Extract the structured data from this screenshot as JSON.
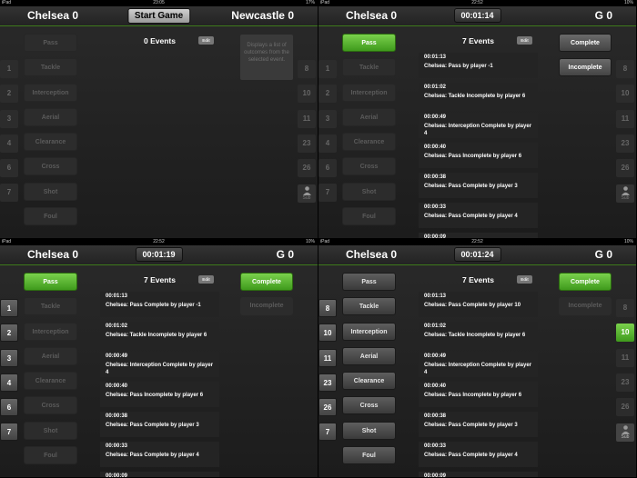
{
  "panels": [
    {
      "status": {
        "carrier": "iPad",
        "time": "23:05",
        "battery": "17%"
      },
      "home": "Chelsea 0",
      "away": "Newcastle 0",
      "clock": "Start Game",
      "events_count": "0 Events",
      "edit": "Edit",
      "hint": "Displays a list of outcomes from the selected event.",
      "events": [
        {
          "label": "Pass",
          "state": "disabled"
        },
        {
          "label": "Tackle",
          "state": "disabled"
        },
        {
          "label": "Interception",
          "state": "disabled"
        },
        {
          "label": "Aerial",
          "state": "disabled"
        },
        {
          "label": "Clearance",
          "state": "disabled"
        },
        {
          "label": "Cross",
          "state": "disabled"
        },
        {
          "label": "Shot",
          "state": "disabled"
        },
        {
          "label": "Foul",
          "state": "disabled"
        }
      ],
      "left_numbers": [
        {
          "n": "1",
          "state": "disabled"
        },
        {
          "n": "2",
          "state": "disabled"
        },
        {
          "n": "3",
          "state": "disabled"
        },
        {
          "n": "4",
          "state": "disabled"
        },
        {
          "n": "6",
          "state": "disabled"
        },
        {
          "n": "7",
          "state": "disabled"
        }
      ],
      "right_numbers": [
        {
          "n": "8",
          "state": "disabled"
        },
        {
          "n": "10",
          "state": "disabled"
        },
        {
          "n": "11",
          "state": "disabled"
        },
        {
          "n": "23",
          "state": "disabled"
        },
        {
          "n": "26",
          "state": "disabled"
        }
      ],
      "sub_label": "Sub",
      "sub_state": "disabled",
      "outcomes": [],
      "log": []
    },
    {
      "status": {
        "carrier": "iPad",
        "time": "22:52",
        "battery": "10%"
      },
      "home": "Chelsea 0",
      "away": "G 0",
      "clock": "00:01:14",
      "events_count": "7 Events",
      "edit": "Edit",
      "hint": "",
      "events": [
        {
          "label": "Pass",
          "state": "active"
        },
        {
          "label": "Tackle",
          "state": "disabled"
        },
        {
          "label": "Interception",
          "state": "disabled"
        },
        {
          "label": "Aerial",
          "state": "disabled"
        },
        {
          "label": "Clearance",
          "state": "disabled"
        },
        {
          "label": "Cross",
          "state": "disabled"
        },
        {
          "label": "Shot",
          "state": "disabled"
        },
        {
          "label": "Foul",
          "state": "disabled"
        }
      ],
      "left_numbers": [
        {
          "n": "1",
          "state": "disabled"
        },
        {
          "n": "2",
          "state": "disabled"
        },
        {
          "n": "3",
          "state": "disabled"
        },
        {
          "n": "4",
          "state": "disabled"
        },
        {
          "n": "6",
          "state": "disabled"
        },
        {
          "n": "7",
          "state": "disabled"
        }
      ],
      "right_numbers": [
        {
          "n": "8",
          "state": "disabled"
        },
        {
          "n": "10",
          "state": "disabled"
        },
        {
          "n": "11",
          "state": "disabled"
        },
        {
          "n": "23",
          "state": "disabled"
        },
        {
          "n": "26",
          "state": "disabled"
        }
      ],
      "sub_label": "Sub",
      "sub_state": "disabled",
      "outcomes": [
        {
          "label": "Complete",
          "state": "normal"
        },
        {
          "label": "Incomplete",
          "state": "normal"
        }
      ],
      "log": [
        {
          "time": "00:01:13",
          "text": "Chelsea: Pass by player -1"
        },
        {
          "time": "00:01:02",
          "text": "Chelsea: Tackle Incomplete by player 6"
        },
        {
          "time": "00:00:49",
          "text": "Chelsea: Interception Complete by player 4"
        },
        {
          "time": "00:00:40",
          "text": "Chelsea: Pass Incomplete by player 6"
        },
        {
          "time": "00:00:38",
          "text": "Chelsea: Pass Complete by player 3"
        },
        {
          "time": "00:00:33",
          "text": "Chelsea: Pass Complete by player 4"
        },
        {
          "time": "00:00:09",
          "text": ""
        }
      ]
    },
    {
      "status": {
        "carrier": "iPad",
        "time": "22:52",
        "battery": "10%"
      },
      "home": "Chelsea 0",
      "away": "G 0",
      "clock": "00:01:19",
      "events_count": "7 Events",
      "edit": "Edit",
      "hint": "",
      "events": [
        {
          "label": "Pass",
          "state": "active"
        },
        {
          "label": "Tackle",
          "state": "disabled"
        },
        {
          "label": "Interception",
          "state": "disabled"
        },
        {
          "label": "Aerial",
          "state": "disabled"
        },
        {
          "label": "Clearance",
          "state": "disabled"
        },
        {
          "label": "Cross",
          "state": "disabled"
        },
        {
          "label": "Shot",
          "state": "disabled"
        },
        {
          "label": "Foul",
          "state": "disabled"
        }
      ],
      "left_numbers": [
        {
          "n": "1",
          "state": "normal"
        },
        {
          "n": "2",
          "state": "normal"
        },
        {
          "n": "3",
          "state": "normal"
        },
        {
          "n": "4",
          "state": "normal"
        },
        {
          "n": "6",
          "state": "normal"
        },
        {
          "n": "7",
          "state": "normal"
        }
      ],
      "right_numbers": [],
      "sub_label": "",
      "sub_state": "",
      "outcomes": [
        {
          "label": "Complete",
          "state": "active"
        },
        {
          "label": "Incomplete",
          "state": "disabled"
        }
      ],
      "log": [
        {
          "time": "00:01:13",
          "text": "Chelsea: Pass Complete by player -1"
        },
        {
          "time": "00:01:02",
          "text": "Chelsea: Tackle Incomplete by player 6"
        },
        {
          "time": "00:00:49",
          "text": "Chelsea: Interception Complete by player 4"
        },
        {
          "time": "00:00:40",
          "text": "Chelsea: Pass Incomplete by player 6"
        },
        {
          "time": "00:00:38",
          "text": "Chelsea: Pass Complete by player 3"
        },
        {
          "time": "00:00:33",
          "text": "Chelsea: Pass Complete by player 4"
        },
        {
          "time": "00:00:09",
          "text": ""
        }
      ]
    },
    {
      "status": {
        "carrier": "iPad",
        "time": "22:52",
        "battery": "10%"
      },
      "home": "Chelsea 0",
      "away": "G 0",
      "clock": "00:01:24",
      "events_count": "7 Events",
      "edit": "Edit",
      "hint": "",
      "events": [
        {
          "label": "Pass",
          "state": "normal"
        },
        {
          "label": "Tackle",
          "state": "normal"
        },
        {
          "label": "Interception",
          "state": "normal"
        },
        {
          "label": "Aerial",
          "state": "normal"
        },
        {
          "label": "Clearance",
          "state": "normal"
        },
        {
          "label": "Cross",
          "state": "normal"
        },
        {
          "label": "Shot",
          "state": "normal"
        },
        {
          "label": "Foul",
          "state": "normal"
        }
      ],
      "left_numbers": [
        {
          "n": "8",
          "state": "normal"
        },
        {
          "n": "10",
          "state": "normal"
        },
        {
          "n": "11",
          "state": "normal"
        },
        {
          "n": "23",
          "state": "normal"
        },
        {
          "n": "26",
          "state": "normal"
        },
        {
          "n": "7",
          "state": "normal"
        }
      ],
      "right_numbers": [
        {
          "n": "8",
          "state": "disabled"
        },
        {
          "n": "10",
          "state": "active"
        },
        {
          "n": "11",
          "state": "disabled"
        },
        {
          "n": "23",
          "state": "disabled"
        },
        {
          "n": "26",
          "state": "disabled"
        }
      ],
      "sub_label": "Sub",
      "sub_state": "normal",
      "outcomes": [
        {
          "label": "Complete",
          "state": "active"
        },
        {
          "label": "Incomplete",
          "state": "disabled"
        }
      ],
      "log": [
        {
          "time": "00:01:13",
          "text": "Chelsea: Pass Complete by player 10"
        },
        {
          "time": "00:01:02",
          "text": "Chelsea: Tackle Incomplete by player 6"
        },
        {
          "time": "00:00:49",
          "text": "Chelsea: Interception Complete by player 4"
        },
        {
          "time": "00:00:40",
          "text": "Chelsea: Pass Incomplete by player 6"
        },
        {
          "time": "00:00:38",
          "text": "Chelsea: Pass Complete by player 3"
        },
        {
          "time": "00:00:33",
          "text": "Chelsea: Pass Complete by player 4"
        },
        {
          "time": "00:00:09",
          "text": ""
        }
      ]
    }
  ]
}
